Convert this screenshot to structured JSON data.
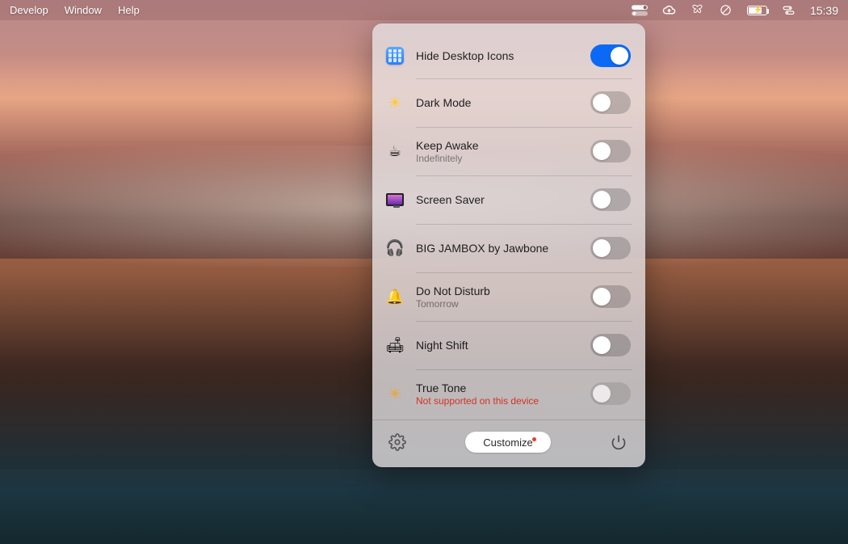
{
  "menubar": {
    "left": {
      "develop": "Develop",
      "window": "Window",
      "help": "Help"
    },
    "right": {
      "time": "15:39"
    }
  },
  "panel": {
    "items": [
      {
        "label": "Hide Desktop Icons",
        "sublabel": "",
        "on": true
      },
      {
        "label": "Dark Mode",
        "sublabel": "",
        "on": false
      },
      {
        "label": "Keep Awake",
        "sublabel": "Indefinitely",
        "on": false
      },
      {
        "label": "Screen Saver",
        "sublabel": "",
        "on": false
      },
      {
        "label": "BIG JAMBOX by Jawbone",
        "sublabel": "",
        "on": false
      },
      {
        "label": "Do Not Disturb",
        "sublabel": "Tomorrow",
        "on": false
      },
      {
        "label": "Night Shift",
        "sublabel": "",
        "on": false
      },
      {
        "label": "True Tone",
        "sublabel": "Not supported on this device",
        "on": false,
        "disabled": true,
        "red": true
      }
    ],
    "customize": "Customize"
  }
}
